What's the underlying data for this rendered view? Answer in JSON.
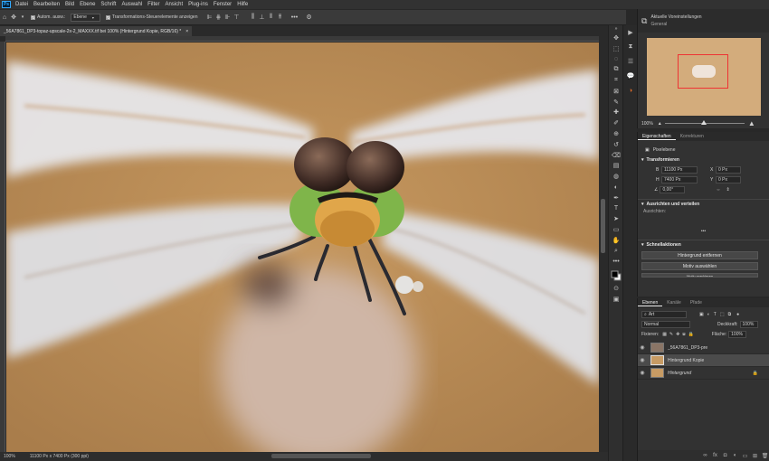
{
  "app": {
    "logo": "Ps"
  },
  "menu": [
    "Datei",
    "Bearbeiten",
    "Bild",
    "Ebene",
    "Schrift",
    "Auswahl",
    "Filter",
    "Ansicht",
    "Plug-ins",
    "Fenster",
    "Hilfe"
  ],
  "options": {
    "auto_select_label": "Autom. ausw.:",
    "auto_select_target": "Ebene",
    "transform_controls_label": "Transformations-Steuerelemente anzeigen"
  },
  "document": {
    "tab_title": "_56A7861_DP3-topaz-upscale-2x-2_MAXXX.tif bei 100% (Hintergrund Kopie, RGB/16) *",
    "close_symbol": "×"
  },
  "status": {
    "zoom": "100%",
    "doc_info": "11100 Px x 7400 Px (300 ppi)"
  },
  "navigator": {
    "preset_title": "Aktuelle Voreinstellungen",
    "preset_value": "General",
    "zoom": "100%"
  },
  "properties": {
    "tabs": [
      "Eigenschaften",
      "Korrekturen"
    ],
    "layer_type": "Pixelebene",
    "transform_title": "Transformieren",
    "w_label": "B",
    "w_value": "11100 Px",
    "h_label": "H",
    "h_value": "7400 Px",
    "x_label": "X",
    "x_value": "0 Px",
    "y_label": "Y",
    "y_value": "0 Px",
    "angle": "0,00°",
    "align_title": "Ausrichten und verteilen",
    "align_sub": "Ausrichten:",
    "more": "•••",
    "quick_title": "Schnellaktionen",
    "quick_btn_1": "Hintergrund entfernen",
    "quick_btn_2": "Motiv auswählen",
    "quick_btn_3": "Motiv maskieren"
  },
  "layers": {
    "tabs": [
      "Ebenen",
      "Kanäle",
      "Pfade"
    ],
    "filter_label": "Art",
    "blend_mode": "Normal",
    "opacity_label": "Deckkraft:",
    "opacity_value": "100%",
    "lock_label": "Fixieren:",
    "fill_label": "Fläche:",
    "fill_value": "100%",
    "items": [
      {
        "name": "_56A7861_DP3-pre",
        "selected": false
      },
      {
        "name": "Hintergrund Kopie",
        "selected": true
      },
      {
        "name": "Hintergrund",
        "selected": false
      }
    ]
  },
  "colors": {
    "panel": "#323232",
    "selected_layer": "#4b4b4b",
    "canvas_bg": "#b8895a"
  }
}
